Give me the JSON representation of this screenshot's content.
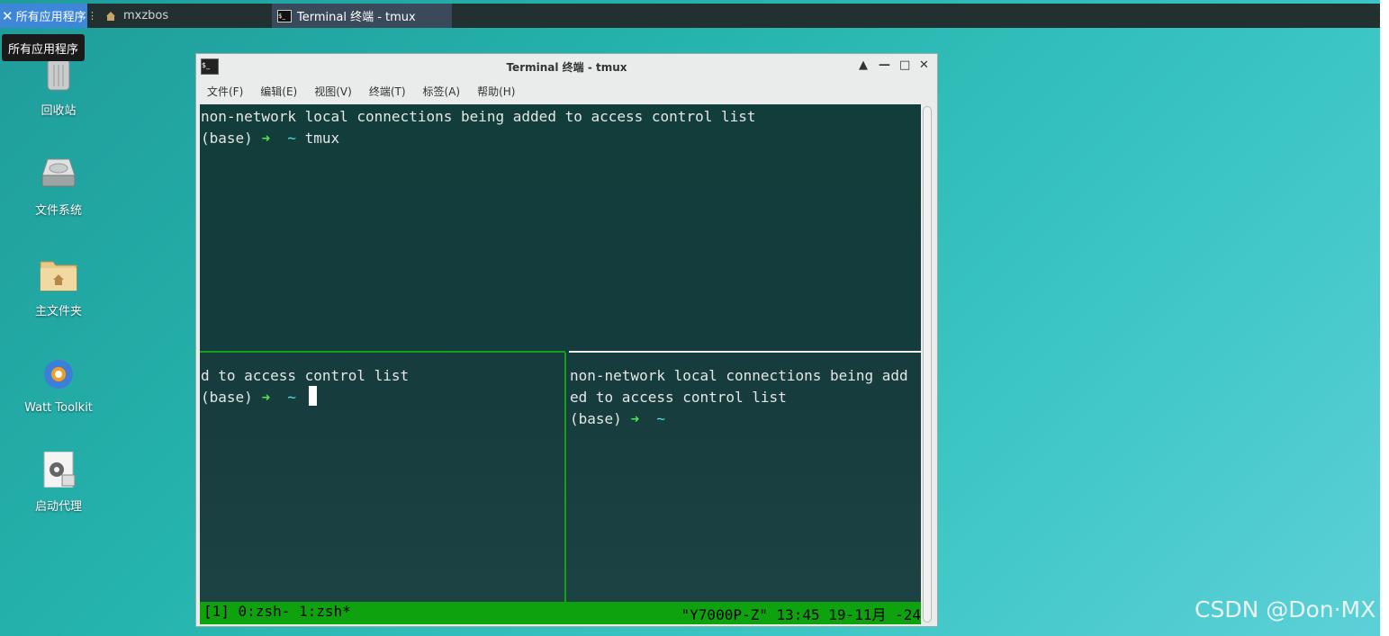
{
  "taskbar": {
    "apps_label": "所有应用程序",
    "separator": "⋮",
    "home_task_label": "mxzbos",
    "terminal_task_label": "Terminal 终端 - tmux"
  },
  "tooltip": {
    "text": "所有应用程序"
  },
  "desktop_icons": [
    {
      "label": "回收站",
      "icon": "trash-icon"
    },
    {
      "label": "文件系统",
      "icon": "drive-icon"
    },
    {
      "label": "主文件夹",
      "icon": "home-folder-icon"
    },
    {
      "label": "Watt Toolkit",
      "icon": "gear-app-icon"
    },
    {
      "label": "启动代理",
      "icon": "proxy-settings-icon"
    }
  ],
  "window": {
    "title": "Terminal 终端 - tmux",
    "controls": [
      "▲",
      "—",
      "□",
      "✕"
    ],
    "menu": [
      "文件(F)",
      "编辑(E)",
      "视图(V)",
      "终端(T)",
      "标签(A)",
      "帮助(H)"
    ]
  },
  "terminal": {
    "top_pane": {
      "line1": "non-network local connections being added to access control list",
      "prompt_base": "(base) ",
      "arrow": "➜",
      "tilde": "~",
      "command": "tmux"
    },
    "bottom_left_pane": {
      "line1": "d to access control list",
      "prompt_base": "(base) ",
      "arrow": "➜",
      "tilde": "~"
    },
    "bottom_right_pane": {
      "line1": "non-network local connections being add",
      "line2": "ed to access control list",
      "prompt_base": "(base) ",
      "arrow": "➜",
      "tilde": "~"
    },
    "status_left": "[1] 0:zsh- 1:zsh*",
    "status_right": "\"Y7000P-Z\" 13:45 19-11月 -24"
  },
  "watermark": "CSDN @Don·MX",
  "colors": {
    "status_bar": "#0ea20e",
    "prompt_arrow": "#4fe84f",
    "prompt_tilde": "#4fe0e0",
    "active_pane_border": "#16a016",
    "taskbar_bg": "#22312f",
    "apps_button": "#3d86d8"
  }
}
